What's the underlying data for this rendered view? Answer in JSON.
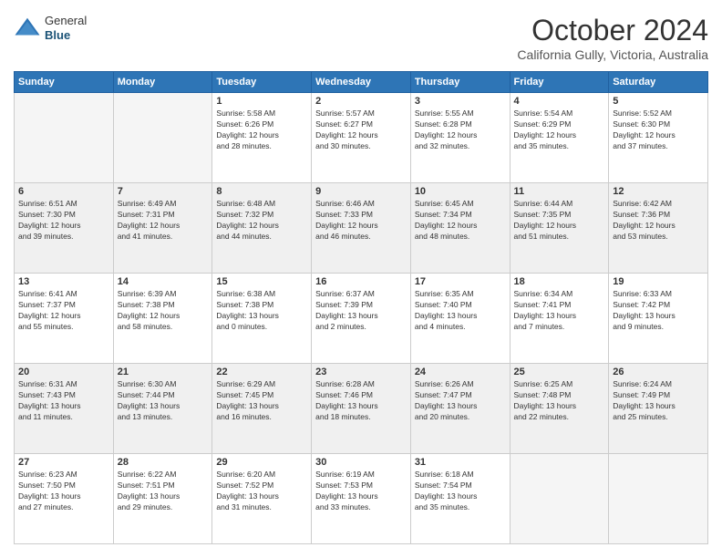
{
  "logo": {
    "general": "General",
    "blue": "Blue"
  },
  "header": {
    "title": "October 2024",
    "subtitle": "California Gully, Victoria, Australia"
  },
  "days_of_week": [
    "Sunday",
    "Monday",
    "Tuesday",
    "Wednesday",
    "Thursday",
    "Friday",
    "Saturday"
  ],
  "weeks": [
    [
      {
        "day": "",
        "detail": ""
      },
      {
        "day": "",
        "detail": ""
      },
      {
        "day": "1",
        "detail": "Sunrise: 5:58 AM\nSunset: 6:26 PM\nDaylight: 12 hours\nand 28 minutes."
      },
      {
        "day": "2",
        "detail": "Sunrise: 5:57 AM\nSunset: 6:27 PM\nDaylight: 12 hours\nand 30 minutes."
      },
      {
        "day": "3",
        "detail": "Sunrise: 5:55 AM\nSunset: 6:28 PM\nDaylight: 12 hours\nand 32 minutes."
      },
      {
        "day": "4",
        "detail": "Sunrise: 5:54 AM\nSunset: 6:29 PM\nDaylight: 12 hours\nand 35 minutes."
      },
      {
        "day": "5",
        "detail": "Sunrise: 5:52 AM\nSunset: 6:30 PM\nDaylight: 12 hours\nand 37 minutes."
      }
    ],
    [
      {
        "day": "6",
        "detail": "Sunrise: 6:51 AM\nSunset: 7:30 PM\nDaylight: 12 hours\nand 39 minutes."
      },
      {
        "day": "7",
        "detail": "Sunrise: 6:49 AM\nSunset: 7:31 PM\nDaylight: 12 hours\nand 41 minutes."
      },
      {
        "day": "8",
        "detail": "Sunrise: 6:48 AM\nSunset: 7:32 PM\nDaylight: 12 hours\nand 44 minutes."
      },
      {
        "day": "9",
        "detail": "Sunrise: 6:46 AM\nSunset: 7:33 PM\nDaylight: 12 hours\nand 46 minutes."
      },
      {
        "day": "10",
        "detail": "Sunrise: 6:45 AM\nSunset: 7:34 PM\nDaylight: 12 hours\nand 48 minutes."
      },
      {
        "day": "11",
        "detail": "Sunrise: 6:44 AM\nSunset: 7:35 PM\nDaylight: 12 hours\nand 51 minutes."
      },
      {
        "day": "12",
        "detail": "Sunrise: 6:42 AM\nSunset: 7:36 PM\nDaylight: 12 hours\nand 53 minutes."
      }
    ],
    [
      {
        "day": "13",
        "detail": "Sunrise: 6:41 AM\nSunset: 7:37 PM\nDaylight: 12 hours\nand 55 minutes."
      },
      {
        "day": "14",
        "detail": "Sunrise: 6:39 AM\nSunset: 7:38 PM\nDaylight: 12 hours\nand 58 minutes."
      },
      {
        "day": "15",
        "detail": "Sunrise: 6:38 AM\nSunset: 7:38 PM\nDaylight: 13 hours\nand 0 minutes."
      },
      {
        "day": "16",
        "detail": "Sunrise: 6:37 AM\nSunset: 7:39 PM\nDaylight: 13 hours\nand 2 minutes."
      },
      {
        "day": "17",
        "detail": "Sunrise: 6:35 AM\nSunset: 7:40 PM\nDaylight: 13 hours\nand 4 minutes."
      },
      {
        "day": "18",
        "detail": "Sunrise: 6:34 AM\nSunset: 7:41 PM\nDaylight: 13 hours\nand 7 minutes."
      },
      {
        "day": "19",
        "detail": "Sunrise: 6:33 AM\nSunset: 7:42 PM\nDaylight: 13 hours\nand 9 minutes."
      }
    ],
    [
      {
        "day": "20",
        "detail": "Sunrise: 6:31 AM\nSunset: 7:43 PM\nDaylight: 13 hours\nand 11 minutes."
      },
      {
        "day": "21",
        "detail": "Sunrise: 6:30 AM\nSunset: 7:44 PM\nDaylight: 13 hours\nand 13 minutes."
      },
      {
        "day": "22",
        "detail": "Sunrise: 6:29 AM\nSunset: 7:45 PM\nDaylight: 13 hours\nand 16 minutes."
      },
      {
        "day": "23",
        "detail": "Sunrise: 6:28 AM\nSunset: 7:46 PM\nDaylight: 13 hours\nand 18 minutes."
      },
      {
        "day": "24",
        "detail": "Sunrise: 6:26 AM\nSunset: 7:47 PM\nDaylight: 13 hours\nand 20 minutes."
      },
      {
        "day": "25",
        "detail": "Sunrise: 6:25 AM\nSunset: 7:48 PM\nDaylight: 13 hours\nand 22 minutes."
      },
      {
        "day": "26",
        "detail": "Sunrise: 6:24 AM\nSunset: 7:49 PM\nDaylight: 13 hours\nand 25 minutes."
      }
    ],
    [
      {
        "day": "27",
        "detail": "Sunrise: 6:23 AM\nSunset: 7:50 PM\nDaylight: 13 hours\nand 27 minutes."
      },
      {
        "day": "28",
        "detail": "Sunrise: 6:22 AM\nSunset: 7:51 PM\nDaylight: 13 hours\nand 29 minutes."
      },
      {
        "day": "29",
        "detail": "Sunrise: 6:20 AM\nSunset: 7:52 PM\nDaylight: 13 hours\nand 31 minutes."
      },
      {
        "day": "30",
        "detail": "Sunrise: 6:19 AM\nSunset: 7:53 PM\nDaylight: 13 hours\nand 33 minutes."
      },
      {
        "day": "31",
        "detail": "Sunrise: 6:18 AM\nSunset: 7:54 PM\nDaylight: 13 hours\nand 35 minutes."
      },
      {
        "day": "",
        "detail": ""
      },
      {
        "day": "",
        "detail": ""
      }
    ]
  ]
}
